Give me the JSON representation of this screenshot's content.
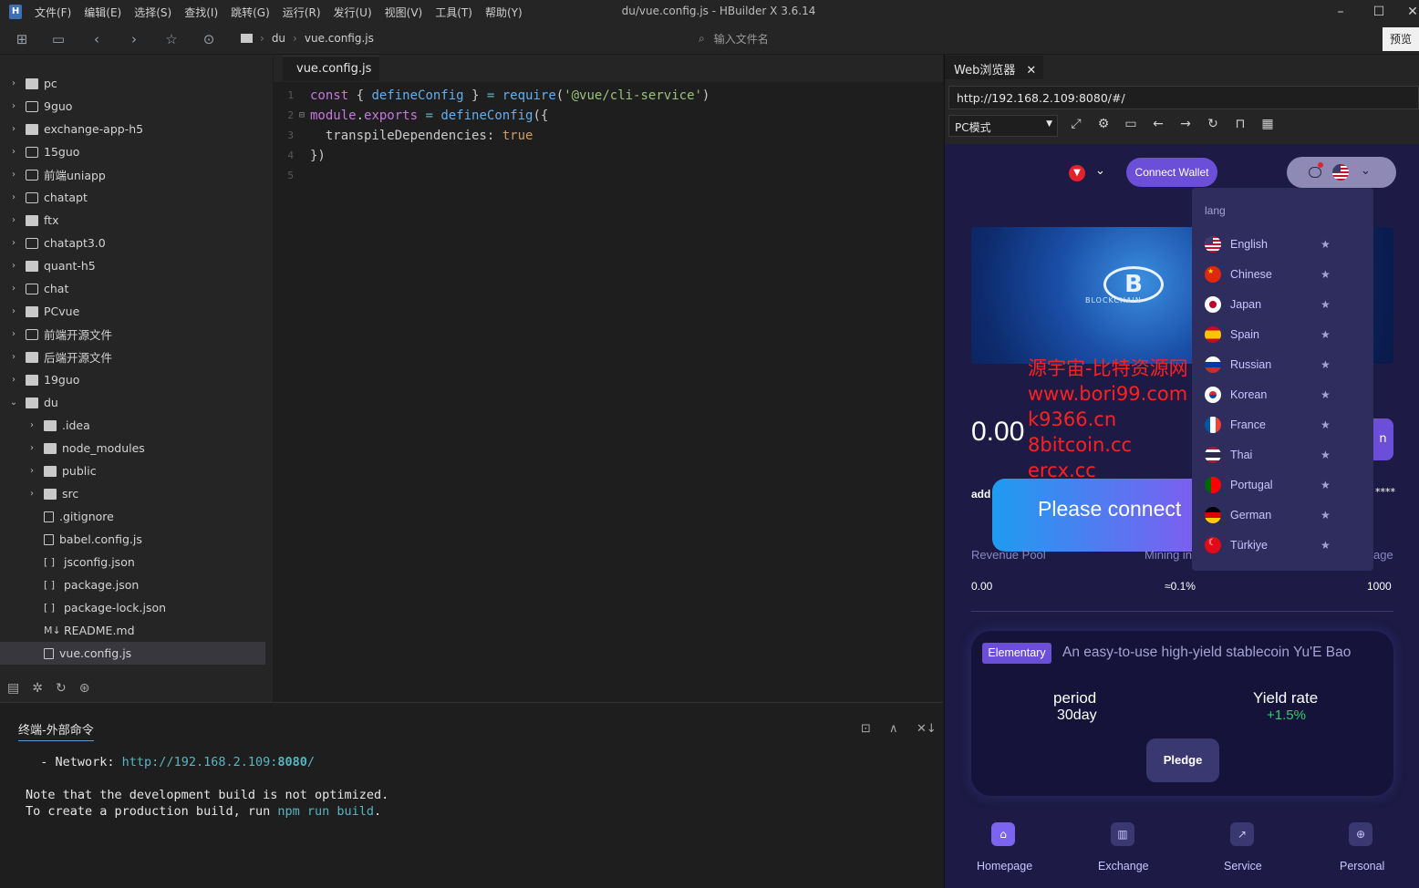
{
  "app": {
    "logo": "H",
    "title": "du/vue.config.js - HBuilder X 3.6.14",
    "menus": [
      "文件(F)",
      "编辑(E)",
      "选择(S)",
      "查找(I)",
      "跳转(G)",
      "运行(R)",
      "发行(U)",
      "视图(V)",
      "工具(T)",
      "帮助(Y)"
    ],
    "window_controls": {
      "minimize": "–",
      "maximize": "☐",
      "close": "✕"
    }
  },
  "toolbar": {
    "breadcrumb": [
      "du",
      "vue.config.js"
    ],
    "search_placeholder": "输入文件名",
    "preview_label": "预览"
  },
  "sidebar": {
    "items": [
      {
        "label": "pc",
        "icon": "folder",
        "chev": "›"
      },
      {
        "label": "9guo",
        "icon": "project",
        "chev": "›"
      },
      {
        "label": "exchange-app-h5",
        "icon": "folder",
        "chev": "›"
      },
      {
        "label": "15guo",
        "icon": "project",
        "chev": "›"
      },
      {
        "label": "前端uniapp",
        "icon": "project",
        "chev": "›"
      },
      {
        "label": "chatapt",
        "icon": "project",
        "chev": "›"
      },
      {
        "label": "ftx",
        "icon": "folder",
        "chev": "›"
      },
      {
        "label": "chatapt3.0",
        "icon": "project",
        "chev": "›"
      },
      {
        "label": "quant-h5",
        "icon": "folder",
        "chev": "›"
      },
      {
        "label": "chat",
        "icon": "project",
        "chev": "›"
      },
      {
        "label": "PCvue",
        "icon": "folder",
        "chev": "›"
      },
      {
        "label": "前端开源文件",
        "icon": "project",
        "chev": "›"
      },
      {
        "label": "后端开源文件",
        "icon": "folder",
        "chev": "›"
      },
      {
        "label": "19guo",
        "icon": "folder",
        "chev": "›"
      },
      {
        "label": "du",
        "icon": "folder",
        "chev": "⌄"
      },
      {
        "label": ".idea",
        "icon": "folder",
        "chev": "›",
        "indent": 1
      },
      {
        "label": "node_modules",
        "icon": "folder",
        "chev": "›",
        "indent": 1
      },
      {
        "label": "public",
        "icon": "folder",
        "chev": "›",
        "indent": 1
      },
      {
        "label": "src",
        "icon": "folder",
        "chev": "›",
        "indent": 1
      },
      {
        "label": ".gitignore",
        "icon": "file",
        "chev": "",
        "indent": 1
      },
      {
        "label": "babel.config.js",
        "icon": "file",
        "chev": "",
        "indent": 1
      },
      {
        "label": "jsconfig.json",
        "icon": "json",
        "chev": "",
        "indent": 1
      },
      {
        "label": "package.json",
        "icon": "json",
        "chev": "",
        "indent": 1
      },
      {
        "label": "package-lock.json",
        "icon": "json",
        "chev": "",
        "indent": 1
      },
      {
        "label": "README.md",
        "icon": "md",
        "chev": "",
        "indent": 1
      },
      {
        "label": "vue.config.js",
        "icon": "file",
        "chev": "",
        "indent": 1,
        "selected": true
      }
    ]
  },
  "editor": {
    "tab": "vue.config.js",
    "lines": [
      {
        "n": "1",
        "fold": "",
        "tokens": [
          [
            "kw",
            "const "
          ],
          [
            "pl",
            "{ "
          ],
          [
            "fn",
            "defineConfig"
          ],
          [
            "pl",
            " } "
          ],
          [
            "op",
            "= "
          ],
          [
            "fn",
            "require"
          ],
          [
            "pl",
            "("
          ],
          [
            "str",
            "'@vue/cli-service'"
          ],
          [
            "pl",
            ")"
          ]
        ]
      },
      {
        "n": "2",
        "fold": "⊟",
        "tokens": [
          [
            "kw",
            "module"
          ],
          [
            "pl",
            "."
          ],
          [
            "kw",
            "exports "
          ],
          [
            "op",
            "= "
          ],
          [
            "fn",
            "defineConfig"
          ],
          [
            "pl",
            "({"
          ]
        ]
      },
      {
        "n": "3",
        "fold": "",
        "tokens": [
          [
            "prop",
            "  transpileDependencies"
          ],
          [
            "pl",
            ": "
          ],
          [
            "bool",
            "true"
          ]
        ]
      },
      {
        "n": "4",
        "fold": "",
        "tokens": [
          [
            "pl",
            "})"
          ]
        ]
      },
      {
        "n": "5",
        "fold": "",
        "tokens": []
      }
    ]
  },
  "terminal": {
    "tab": "终端-外部命令",
    "line1_prefix": "  - Network: ",
    "line1_link": "http://192.168.2.109:",
    "line1_port": "8080",
    "line1_suffix": "/",
    "line2": "Note that the development build is not optimized.",
    "line3_prefix": "To create a production build, run ",
    "line3_cmd": "npm run build",
    "line3_suffix": "."
  },
  "browser": {
    "tab": "Web浏览器",
    "url": "http://192.168.2.109:8080/#/",
    "mode": "PC模式"
  },
  "dapp": {
    "connect_wallet": "Connect Wallet",
    "banner_text": "BLOCKCHAIN",
    "banner_logo": "B",
    "watermark": [
      "源宇宙-比特资源网",
      "www.bori99.com",
      "k9366.cn",
      "8bitcoin.cc",
      "ercx.cc"
    ],
    "balance": "0.00",
    "right_button_fragment": "n",
    "address_label": "add",
    "address_masked": "****",
    "please_connect": "Please connect",
    "stats": {
      "revenue_label": "Revenue Pool",
      "mining_label": "Mining in",
      "age_label": "age",
      "revenue_value": "0.00",
      "mining_value": "≈0.1%",
      "age_value": "1000"
    },
    "card": {
      "badge": "Elementary",
      "desc": "An easy-to-use high-yield stablecoin Yu'E Bao",
      "period_label": "period",
      "period_value": "30day",
      "yield_label": "Yield rate",
      "yield_value": "+1.5%",
      "pledge": "Pledge"
    },
    "nav": [
      {
        "label": "Homepage",
        "icon": "⌂",
        "active": true
      },
      {
        "label": "Exchange",
        "icon": "▥"
      },
      {
        "label": "Service",
        "icon": "↗"
      },
      {
        "label": "Personal",
        "icon": "⊕"
      }
    ],
    "lang_menu": {
      "title": "lang",
      "items": [
        {
          "label": "English",
          "flag": "us"
        },
        {
          "label": "Chinese",
          "flag": "cn"
        },
        {
          "label": "Japan",
          "flag": "jp"
        },
        {
          "label": "Spain",
          "flag": "es"
        },
        {
          "label": "Russian",
          "flag": "ru"
        },
        {
          "label": "Korean",
          "flag": "kr"
        },
        {
          "label": "France",
          "flag": "fr"
        },
        {
          "label": "Thai",
          "flag": "th"
        },
        {
          "label": "Portugal",
          "flag": "pt"
        },
        {
          "label": "German",
          "flag": "de"
        },
        {
          "label": "Türkiye",
          "flag": "tr"
        }
      ]
    }
  }
}
